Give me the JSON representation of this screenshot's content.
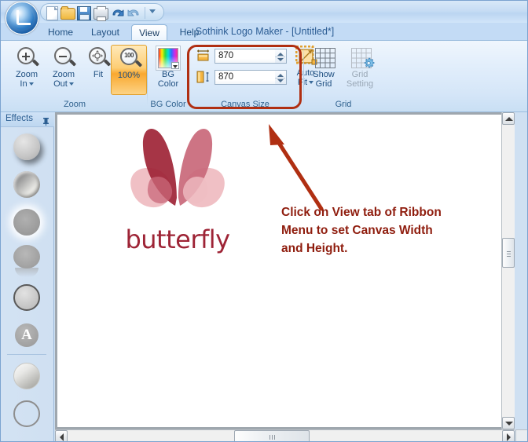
{
  "window": {
    "title": "Sothink Logo Maker - [Untitled*]"
  },
  "quick_access": {
    "buttons": [
      {
        "name": "new-icon",
        "label": "New"
      },
      {
        "name": "open-icon",
        "label": "Open"
      },
      {
        "name": "save-icon",
        "label": "Save"
      },
      {
        "name": "print-icon",
        "label": "Print"
      },
      {
        "name": "undo-icon",
        "label": "Undo"
      },
      {
        "name": "redo-icon",
        "label": "Redo"
      },
      {
        "name": "customize-qat-icon",
        "label": "Customize Quick Access Toolbar"
      }
    ]
  },
  "tabs": [
    {
      "label": "Home",
      "active": false
    },
    {
      "label": "Layout",
      "active": false
    },
    {
      "label": "View",
      "active": true
    },
    {
      "label": "Help",
      "active": false
    }
  ],
  "ribbon": {
    "groups": [
      {
        "label": "Zoom",
        "buttons": [
          {
            "label_line1": "Zoom",
            "label_line2": "In",
            "has_caret": true,
            "selected": false
          },
          {
            "label_line1": "Zoom",
            "label_line2": "Out",
            "has_caret": true,
            "selected": false
          },
          {
            "label_line1": "Fit",
            "label_line2": "",
            "has_caret": false,
            "selected": false
          },
          {
            "label_line1": "100%",
            "label_line2": "",
            "has_caret": false,
            "selected": true
          }
        ]
      },
      {
        "label": "BG Color",
        "buttons": [
          {
            "label_line1": "BG",
            "label_line2": "Color",
            "has_caret": false,
            "selected": false
          }
        ]
      },
      {
        "label": "Canvas Size",
        "width_value": "870",
        "height_value": "870",
        "autofit_line1": "Auto",
        "autofit_line2": "Fit",
        "autofit_has_caret": true,
        "highlighted": true
      },
      {
        "label": "Grid",
        "buttons": [
          {
            "label_line1": "Show",
            "label_line2": "Grid",
            "has_caret": false,
            "disabled": false
          },
          {
            "label_line1": "Grid",
            "label_line2": "Setting",
            "has_caret": false,
            "disabled": true
          }
        ]
      }
    ]
  },
  "effects_panel": {
    "title": "Effects",
    "pin_icon": "pin-icon",
    "items": [
      {
        "name": "effect-drop-shadow"
      },
      {
        "name": "effect-bevel"
      },
      {
        "name": "effect-glow"
      },
      {
        "name": "effect-reflection"
      },
      {
        "name": "effect-outline"
      },
      {
        "name": "effect-text-style"
      },
      {
        "name": "effect-gradient-fill"
      },
      {
        "name": "effect-no-fill"
      }
    ]
  },
  "canvas": {
    "logo_text": "butterfly",
    "logo_colors": {
      "dark_wing": "#9e2436",
      "mid_wing": "#c9687a",
      "light_wing": "#efbdc2",
      "text": "#9e2436"
    },
    "annotation": {
      "line1": "Click on View tab of Ribbon",
      "line2": "Menu to set Canvas Width",
      "line3": "and Height.",
      "color": "#8f1d0e",
      "arrow": "annotation-arrow"
    }
  },
  "scrollbars": {
    "vertical": {
      "up": "scroll-up-arrow",
      "down": "scroll-down-arrow",
      "thumb": "vertical-scroll-thumb"
    },
    "horizontal": {
      "left": "scroll-left-arrow",
      "right": "scroll-right-arrow",
      "thumb": "horizontal-scroll-thumb"
    }
  }
}
